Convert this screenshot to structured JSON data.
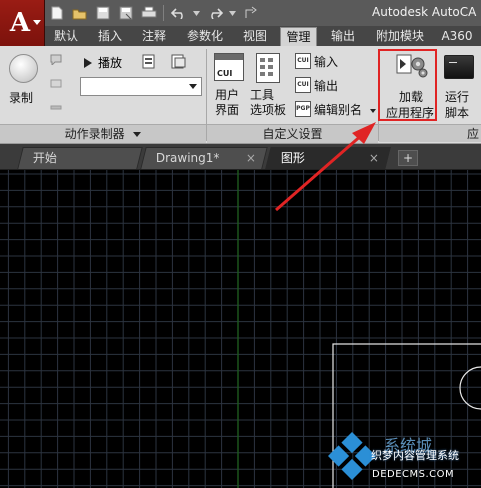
{
  "app": {
    "title": "Autodesk AutoCA",
    "logo_letter": "A",
    "quick_access_icons": [
      "new-icon",
      "open-icon",
      "save-icon",
      "saveas-icon",
      "print-icon",
      "undo-icon",
      "redo-icon",
      "share-icon"
    ]
  },
  "ribbon_tabs": [
    "默认",
    "插入",
    "注释",
    "参数化",
    "视图",
    "管理",
    "输出",
    "附加模块",
    "A360"
  ],
  "active_tab": "管理",
  "panels": {
    "action_recorder": {
      "title": "动作录制器",
      "record_label": "录制",
      "play_label": "播放",
      "combo_value": ""
    },
    "customization": {
      "title": "自定义设置",
      "user_interface_label": "用户\n界面",
      "tool_palettes_label": "工具\n选项板",
      "import_label": "输入",
      "export_label": "输出",
      "edit_aliases_label": "编辑别名"
    },
    "applications": {
      "title_partial": "应",
      "load_app_label_1": "加载",
      "load_app_label_2": "应用程序",
      "run_script_label_1": "运行",
      "run_script_label_2": "脚本"
    }
  },
  "doc_tabs": [
    {
      "label": "开始",
      "active": false
    },
    {
      "label": "Drawing1*",
      "active": false
    },
    {
      "label": "图形",
      "active": true
    }
  ],
  "new_tab_symbol": "+",
  "close_symbol": "×",
  "watermark": {
    "line1": "织梦内容管理系统",
    "line2": "DEDECMS.COM",
    "logo_text": "系统城"
  },
  "colors": {
    "app_button": "#9a1c14",
    "highlight": "#e02424",
    "canvas_bg": "#000000",
    "grid": "#2c3440",
    "axis_green": "#1e5a1e"
  }
}
